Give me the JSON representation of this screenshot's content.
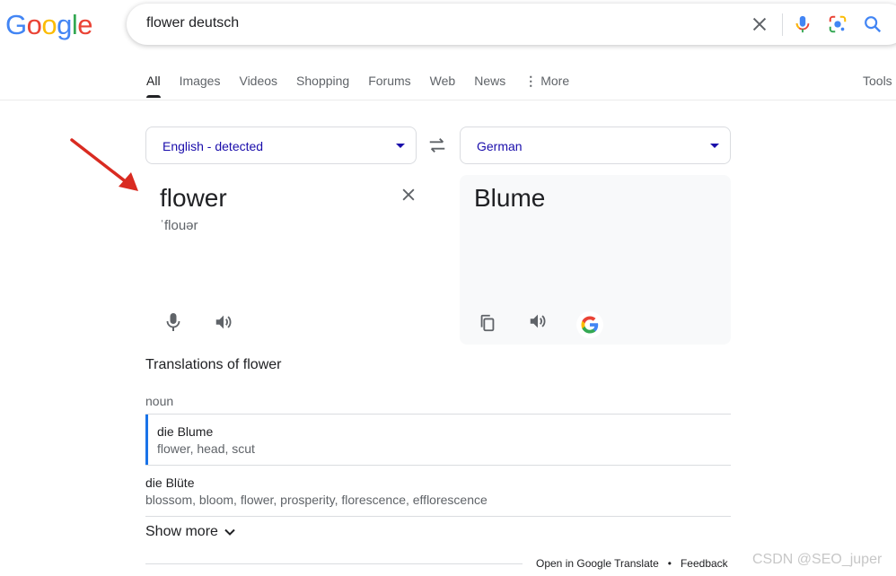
{
  "logo": "Google",
  "search": {
    "query": "flower deutsch"
  },
  "tabs": [
    "All",
    "Images",
    "Videos",
    "Shopping",
    "Forums",
    "Web",
    "News",
    "More"
  ],
  "tools_label": "Tools",
  "translate": {
    "source_lang": "English - detected",
    "target_lang": "German",
    "source_word": "flower",
    "pronunciation": "ˈflouər",
    "target_word": "Blume"
  },
  "translations": {
    "heading": "Translations of flower",
    "part_of_speech": "noun",
    "entries": [
      {
        "word": "die Blume",
        "synonyms": "flower, head, scut"
      },
      {
        "word": "die Blüte",
        "synonyms": "blossom, bloom, flower, prosperity, florescence, efflorescence"
      }
    ],
    "show_more": "Show more"
  },
  "footer": {
    "open_link": "Open in Google Translate",
    "feedback": "Feedback"
  },
  "watermark": "CSDN @SEO_juper",
  "colors": {
    "blue": "#4285F4",
    "red": "#EA4335",
    "yellow": "#FBBC05",
    "green": "#34A853",
    "link": "#1a0dab",
    "highlight_bar": "#1a73e8"
  }
}
